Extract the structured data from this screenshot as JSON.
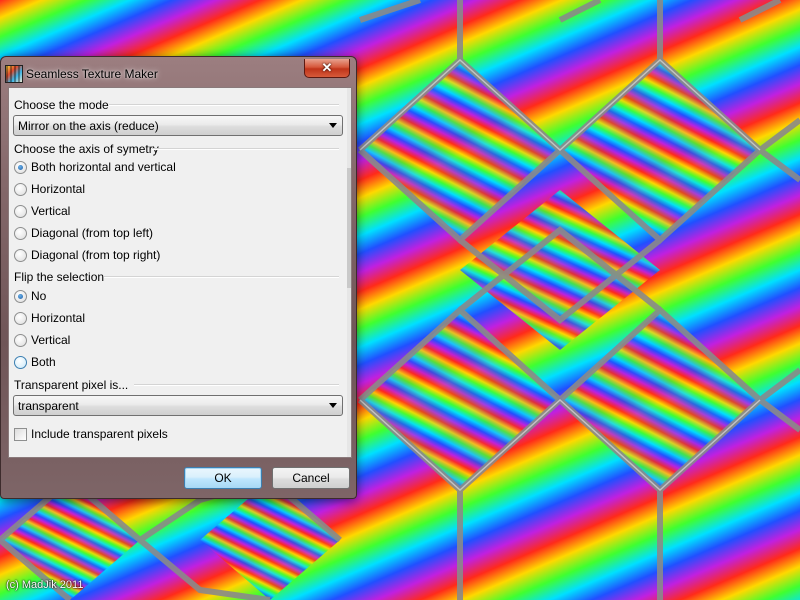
{
  "window": {
    "title": "Seamless Texture Maker",
    "close_glyph": "✕"
  },
  "mode": {
    "label": "Choose the mode",
    "selected": "Mirror on the axis (reduce)"
  },
  "axis": {
    "label": "Choose the axis of symetry",
    "options": [
      {
        "label": "Both horizontal and vertical",
        "checked": true
      },
      {
        "label": "Horizontal",
        "checked": false
      },
      {
        "label": "Vertical",
        "checked": false
      },
      {
        "label": "Diagonal (from top left)",
        "checked": false
      },
      {
        "label": "Diagonal (from top right)",
        "checked": false
      }
    ]
  },
  "flip": {
    "label": "Flip the selection",
    "options": [
      {
        "label": "No",
        "checked": true
      },
      {
        "label": "Horizontal",
        "checked": false
      },
      {
        "label": "Vertical",
        "checked": false
      },
      {
        "label": "Both",
        "checked": false
      }
    ]
  },
  "transparent": {
    "label": "Transparent pixel is...",
    "selected": "transparent",
    "include_label": "Include transparent pixels",
    "include_checked": false
  },
  "buttons": {
    "ok": "OK",
    "cancel": "Cancel"
  },
  "footer": {
    "copyright": "(c) MadJik 2011"
  },
  "colors": {
    "accent": "#1e5fa8",
    "close_red": "#c0341a",
    "frame": "#836769"
  },
  "icons": [
    "app-texture-icon",
    "close-icon",
    "chevron-down-icon"
  ]
}
